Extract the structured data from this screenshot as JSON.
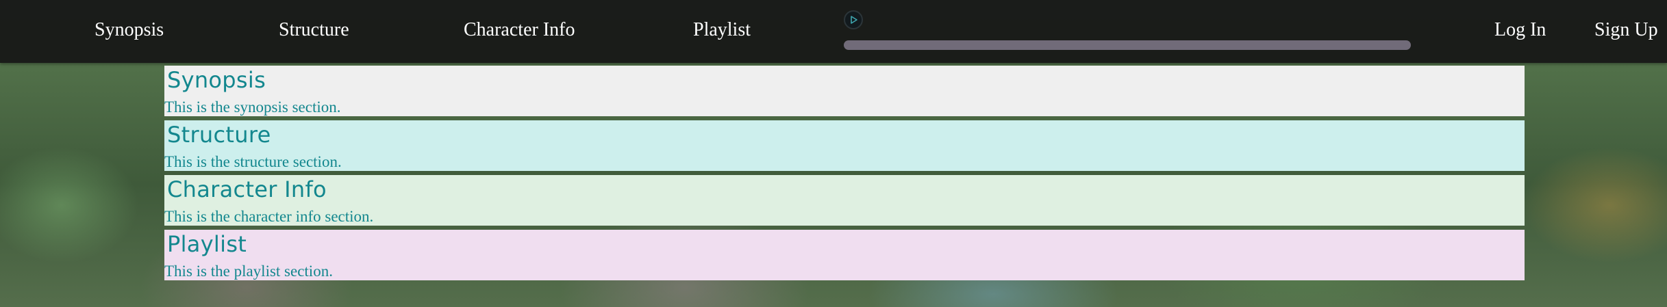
{
  "nav": {
    "links": [
      {
        "label": "Synopsis"
      },
      {
        "label": "Structure"
      },
      {
        "label": "Character Info"
      },
      {
        "label": "Playlist"
      }
    ],
    "login_label": "Log In",
    "signup_label": "Sign Up"
  },
  "player": {
    "play_icon": "play-icon",
    "progress": 0
  },
  "sections": [
    {
      "title": "Synopsis",
      "text": "This is the synopsis section.",
      "bg": "#efefef"
    },
    {
      "title": "Structure",
      "text": "This is the structure section.",
      "bg": "#cdefed"
    },
    {
      "title": "Character Info",
      "text": "This is the character info section.",
      "bg": "#dff0e1"
    },
    {
      "title": "Playlist",
      "text": "This is the playlist section.",
      "bg": "#f0def0"
    }
  ],
  "colors": {
    "nav_bg": "#161616",
    "nav_text": "#ffffff",
    "section_text": "#13878e",
    "progress_track": "#716b79"
  }
}
